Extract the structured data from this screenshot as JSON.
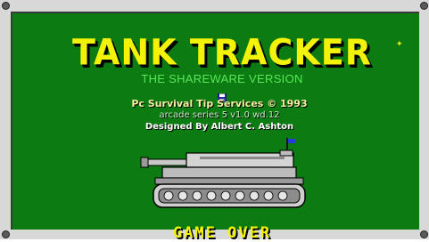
{
  "game": {
    "title": "TANK TRACKER",
    "subtitle": "THE SHAREWARE VERSION",
    "credits": [
      "Pc Survival Tip Services © 1993",
      "arcade series 5 v1.0 wd.12",
      "Designed By Albert C. Ashton"
    ],
    "status": "GAME OVER"
  },
  "colors": {
    "background": "#0c7b12",
    "title": "#f3f30a",
    "subtitle": "#58e858",
    "frame": "#d8d8d8"
  },
  "icons": {
    "tank": "tank-icon",
    "flag": "flag-icon",
    "disk": "floppy-disk-icon"
  }
}
